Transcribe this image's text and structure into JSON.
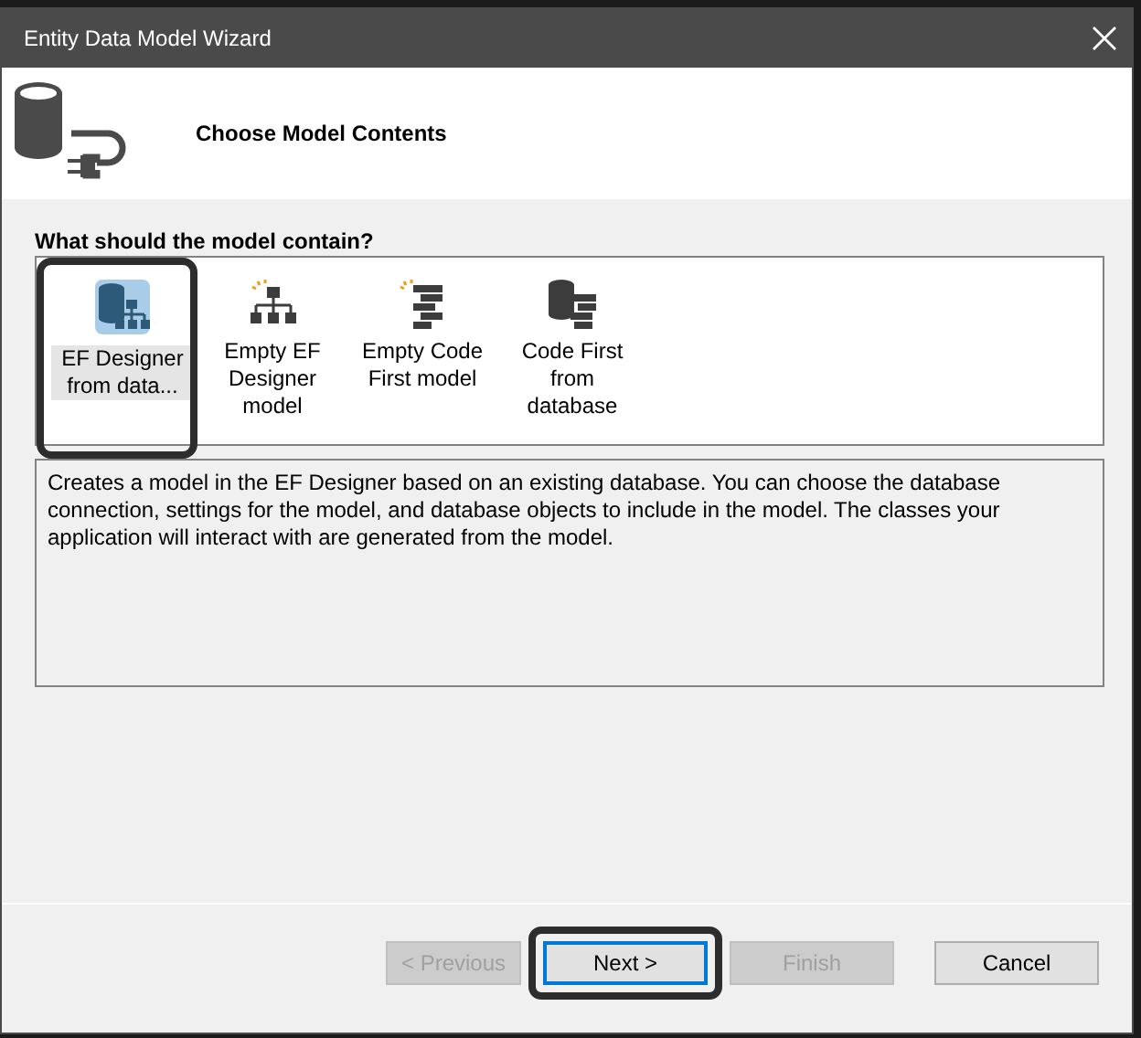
{
  "window": {
    "title": "Entity Data Model Wizard"
  },
  "header": {
    "title": "Choose Model Contents"
  },
  "question": "What should the model contain?",
  "options": [
    {
      "label": "EF Designer from data...",
      "kind": "database-diagram",
      "selected": true,
      "highlighted": true
    },
    {
      "label": "Empty EF Designer model",
      "kind": "diagram",
      "selected": false,
      "highlighted": false
    },
    {
      "label": "Empty Code First model",
      "kind": "code",
      "selected": false,
      "highlighted": false
    },
    {
      "label": "Code First from database",
      "kind": "database-code",
      "selected": false,
      "highlighted": false
    }
  ],
  "description": "Creates a model in the EF Designer based on an existing database. You can choose the database connection, settings for the model, and database objects to include in the model. The classes your application will interact with are generated from the model.",
  "buttons": [
    {
      "label": "< Previous",
      "disabled": true,
      "default": false,
      "highlighted": false
    },
    {
      "label": "Next >",
      "disabled": false,
      "default": true,
      "highlighted": true
    },
    {
      "label": "Finish",
      "disabled": true,
      "default": false,
      "highlighted": false
    },
    {
      "label": "Cancel",
      "disabled": false,
      "default": false,
      "highlighted": false
    }
  ]
}
